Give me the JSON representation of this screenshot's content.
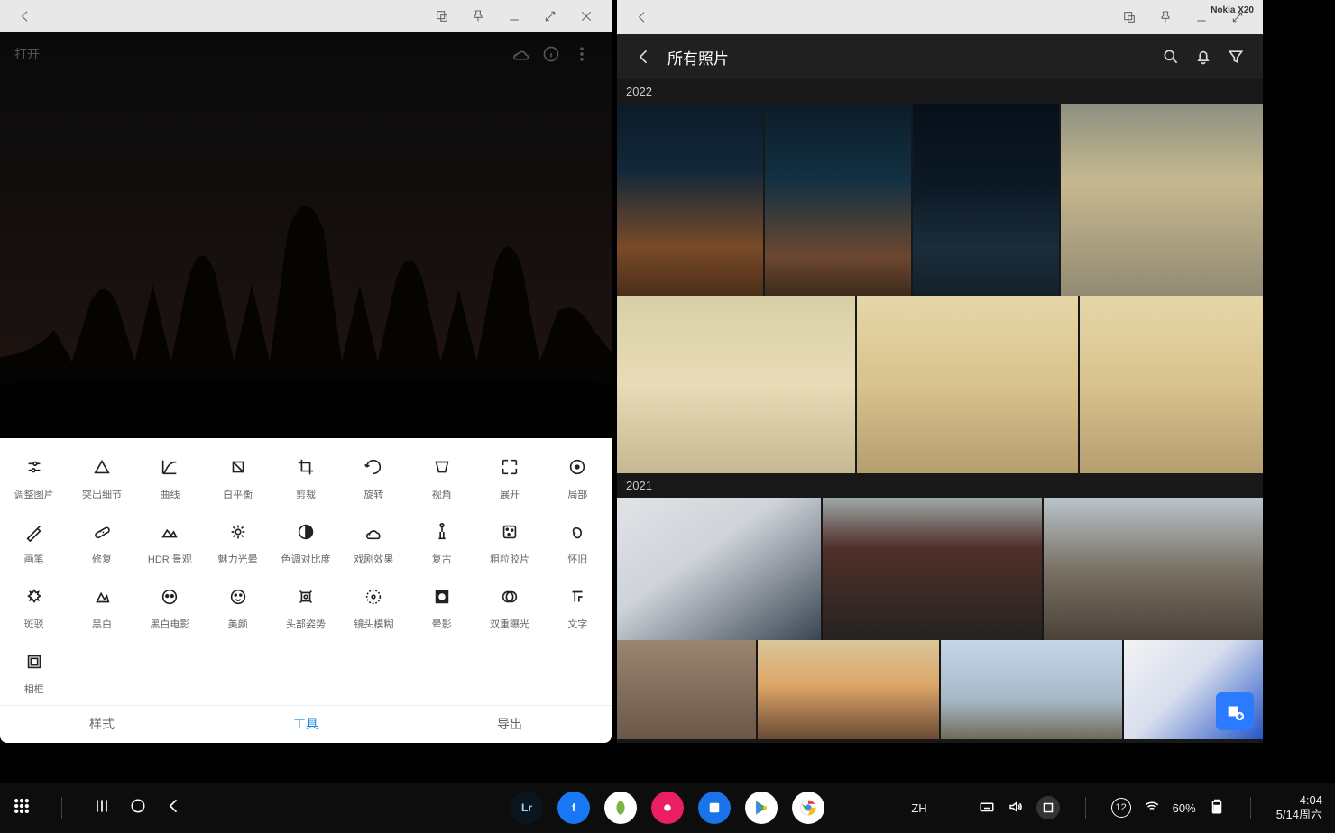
{
  "windowButtons": {
    "back": "←",
    "screenshot": "□",
    "pin": "📌",
    "minimize": "—",
    "maximize": "⤢",
    "close": "✕"
  },
  "editor": {
    "open_label": "打开",
    "tabs": {
      "style": "样式",
      "tool": "工具",
      "export": "导出"
    },
    "tools": [
      {
        "label": "调整图片",
        "icon": "sliders"
      },
      {
        "label": "突出细节",
        "icon": "triangle"
      },
      {
        "label": "曲线",
        "icon": "curves"
      },
      {
        "label": "白平衡",
        "icon": "wb"
      },
      {
        "label": "剪裁",
        "icon": "crop"
      },
      {
        "label": "旋转",
        "icon": "rotate"
      },
      {
        "label": "视角",
        "icon": "perspective"
      },
      {
        "label": "展开",
        "icon": "expand"
      },
      {
        "label": "局部",
        "icon": "target"
      },
      {
        "label": "画笔",
        "icon": "brush"
      },
      {
        "label": "修复",
        "icon": "bandage"
      },
      {
        "label": "HDR 景观",
        "icon": "hdr"
      },
      {
        "label": "魅力光晕",
        "icon": "glow"
      },
      {
        "label": "色调对比度",
        "icon": "contrast"
      },
      {
        "label": "戏剧效果",
        "icon": "drama"
      },
      {
        "label": "复古",
        "icon": "vintage"
      },
      {
        "label": "粗粒胶片",
        "icon": "grain"
      },
      {
        "label": "怀旧",
        "icon": "retro"
      },
      {
        "label": "斑驳",
        "icon": "grunge"
      },
      {
        "label": "黑白",
        "icon": "bw"
      },
      {
        "label": "黑白电影",
        "icon": "noir"
      },
      {
        "label": "美颜",
        "icon": "face"
      },
      {
        "label": "头部姿势",
        "icon": "headpose"
      },
      {
        "label": "镜头模糊",
        "icon": "lensblur"
      },
      {
        "label": "晕影",
        "icon": "vignette"
      },
      {
        "label": "双重曝光",
        "icon": "double"
      },
      {
        "label": "文字",
        "icon": "text"
      },
      {
        "label": "相框",
        "icon": "frame"
      }
    ]
  },
  "gallery": {
    "title": "所有照片",
    "years": [
      "2022",
      "2021"
    ],
    "nokia_label": "Nokia X20"
  },
  "taskbar": {
    "ime": "ZH",
    "notif_count": "12",
    "battery": "60%",
    "time": "4:04",
    "date": "5/14周六"
  }
}
